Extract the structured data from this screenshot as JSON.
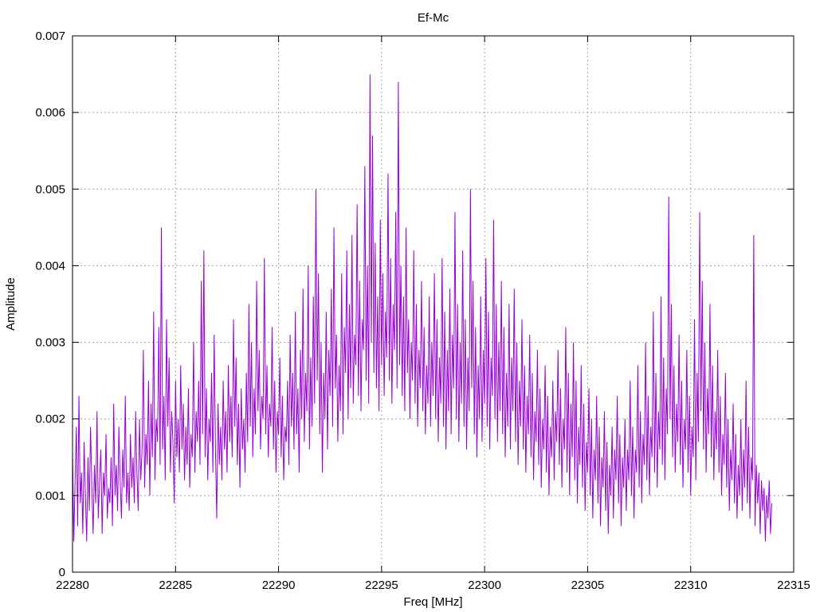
{
  "chart_data": {
    "type": "line",
    "title": "Ef-Mc",
    "xlabel": "Freq [MHz]",
    "ylabel": "Amplitude",
    "xlim": [
      22280,
      22315
    ],
    "ylim": [
      0,
      0.007
    ],
    "xticks": [
      22280,
      22285,
      22290,
      22295,
      22300,
      22305,
      22310,
      22315
    ],
    "yticks": [
      0,
      0.001,
      0.002,
      0.003,
      0.004,
      0.005,
      0.006,
      0.007
    ],
    "xtick_labels": [
      "22280",
      "22285",
      "22290",
      "22295",
      "22300",
      "22305",
      "22310",
      "22315"
    ],
    "ytick_labels": [
      "0",
      "0.001",
      "0.002",
      "0.003",
      "0.004",
      "0.005",
      "0.006",
      "0.007"
    ],
    "grid": true,
    "legend": "none",
    "series_color": "#9400d3",
    "series": [
      {
        "x_start": 22280.0,
        "x_step": 0.0625,
        "values": [
          0.0016,
          0.0004,
          0.0012,
          0.0019,
          0.0006,
          0.0023,
          0.0009,
          0.0013,
          0.0005,
          0.0017,
          0.001,
          0.0004,
          0.0015,
          0.0008,
          0.0019,
          0.0011,
          0.0005,
          0.0014,
          0.0009,
          0.0021,
          0.0007,
          0.0012,
          0.0016,
          0.0005,
          0.0013,
          0.001,
          0.0018,
          0.0007,
          0.0011,
          0.0009,
          0.0015,
          0.0006,
          0.0022,
          0.001,
          0.0014,
          0.0008,
          0.0019,
          0.0012,
          0.0007,
          0.0016,
          0.0011,
          0.0023,
          0.0009,
          0.0013,
          0.0008,
          0.0018,
          0.0011,
          0.0015,
          0.0009,
          0.0021,
          0.0013,
          0.0008,
          0.002,
          0.0012,
          0.0016,
          0.0029,
          0.0011,
          0.0018,
          0.0014,
          0.0025,
          0.001,
          0.0022,
          0.0015,
          0.0034,
          0.0012,
          0.002,
          0.0017,
          0.0032,
          0.0014,
          0.0045,
          0.0016,
          0.0023,
          0.0012,
          0.0033,
          0.0019,
          0.0028,
          0.0013,
          0.0021,
          0.0017,
          0.0009,
          0.0025,
          0.0015,
          0.002,
          0.0013,
          0.0027,
          0.0016,
          0.0022,
          0.0012,
          0.0019,
          0.0014,
          0.0024,
          0.0011,
          0.0018,
          0.0015,
          0.003,
          0.0013,
          0.0021,
          0.0017,
          0.0025,
          0.0014,
          0.0038,
          0.0018,
          0.0042,
          0.0015,
          0.0024,
          0.0012,
          0.002,
          0.0017,
          0.0026,
          0.0013,
          0.0031,
          0.0016,
          0.0007,
          0.0022,
          0.0014,
          0.0019,
          0.0012,
          0.0025,
          0.0016,
          0.0021,
          0.0013,
          0.0027,
          0.0017,
          0.0023,
          0.0015,
          0.0033,
          0.0019,
          0.0028,
          0.0014,
          0.0022,
          0.0011,
          0.0024,
          0.0016,
          0.002,
          0.0013,
          0.0026,
          0.0017,
          0.0035,
          0.0019,
          0.003,
          0.0015,
          0.0024,
          0.0018,
          0.0038,
          0.0021,
          0.0029,
          0.0016,
          0.0023,
          0.002,
          0.0041,
          0.0018,
          0.0027,
          0.0015,
          0.0022,
          0.0019,
          0.0032,
          0.0016,
          0.0025,
          0.0013,
          0.0021,
          0.0018,
          0.0028,
          0.0015,
          0.0023,
          0.0012,
          0.0019,
          0.0017,
          0.0025,
          0.0014,
          0.0031,
          0.0019,
          0.0026,
          0.0016,
          0.0034,
          0.0018,
          0.0024,
          0.0013,
          0.0029,
          0.002,
          0.0037,
          0.0017,
          0.0026,
          0.0021,
          0.004,
          0.0016,
          0.0028,
          0.0019,
          0.0036,
          0.0022,
          0.005,
          0.0025,
          0.0039,
          0.0018,
          0.003,
          0.0013,
          0.0026,
          0.002,
          0.0034,
          0.0016,
          0.0029,
          0.0023,
          0.0037,
          0.0019,
          0.0045,
          0.0024,
          0.0031,
          0.0017,
          0.0027,
          0.0021,
          0.0039,
          0.0018,
          0.0032,
          0.0026,
          0.0042,
          0.002,
          0.0035,
          0.0024,
          0.0044,
          0.0022,
          0.0031,
          0.0027,
          0.0048,
          0.0023,
          0.0038,
          0.0021,
          0.0033,
          0.0029,
          0.0053,
          0.0025,
          0.004,
          0.0022,
          0.0065,
          0.003,
          0.0057,
          0.0026,
          0.0043,
          0.0024,
          0.0036,
          0.0021,
          0.0046,
          0.0027,
          0.0039,
          0.0023,
          0.0034,
          0.0028,
          0.0052,
          0.0025,
          0.0041,
          0.0022,
          0.0035,
          0.0029,
          0.0047,
          0.0024,
          0.0064,
          0.0027,
          0.004,
          0.0023,
          0.0036,
          0.0021,
          0.0045,
          0.0026,
          0.0033,
          0.002,
          0.003,
          0.0025,
          0.0042,
          0.0022,
          0.0035,
          0.0019,
          0.0029,
          0.0024,
          0.0038,
          0.0021,
          0.0032,
          0.0018,
          0.0027,
          0.0022,
          0.0036,
          0.0019,
          0.003,
          0.0023,
          0.0039,
          0.002,
          0.0033,
          0.0017,
          0.0028,
          0.0022,
          0.0041,
          0.0019,
          0.0034,
          0.0016,
          0.0029,
          0.0021,
          0.0037,
          0.0018,
          0.0031,
          0.0024,
          0.0047,
          0.002,
          0.0035,
          0.0017,
          0.003,
          0.0022,
          0.0042,
          0.0019,
          0.0033,
          0.0016,
          0.0028,
          0.0021,
          0.005,
          0.0024,
          0.0038,
          0.0018,
          0.0032,
          0.0015,
          0.0027,
          0.002,
          0.0036,
          0.0017,
          0.0029,
          0.0022,
          0.0041,
          0.0019,
          0.0034,
          0.0016,
          0.0028,
          0.0023,
          0.0046,
          0.002,
          0.0035,
          0.0017,
          0.003,
          0.0021,
          0.0038,
          0.0018,
          0.0032,
          0.0015,
          0.0026,
          0.0019,
          0.0035,
          0.0016,
          0.0028,
          0.0021,
          0.0037,
          0.0017,
          0.003,
          0.0014,
          0.0025,
          0.0019,
          0.0033,
          0.0016,
          0.0027,
          0.0013,
          0.0023,
          0.0018,
          0.0031,
          0.0015,
          0.0026,
          0.0012,
          0.0021,
          0.0017,
          0.0029,
          0.0014,
          0.0024,
          0.0011,
          0.002,
          0.0016,
          0.0027,
          0.0013,
          0.0023,
          0.001,
          0.0019,
          0.0015,
          0.0025,
          0.0012,
          0.0021,
          0.0017,
          0.0029,
          0.0014,
          0.0024,
          0.0011,
          0.002,
          0.0016,
          0.0032,
          0.0013,
          0.0026,
          0.001,
          0.0022,
          0.0015,
          0.003,
          0.0012,
          0.0025,
          0.0009,
          0.0019,
          0.0014,
          0.0027,
          0.0011,
          0.0022,
          0.0008,
          0.0017,
          0.0013,
          0.0024,
          0.001,
          0.002,
          0.0007,
          0.0016,
          0.0012,
          0.0023,
          0.0009,
          0.0019,
          0.0006,
          0.0015,
          0.0011,
          0.0021,
          0.0008,
          0.0017,
          0.0005,
          0.0014,
          0.001,
          0.0019,
          0.0007,
          0.0016,
          0.0012,
          0.0023,
          0.0009,
          0.0018,
          0.0006,
          0.0015,
          0.0011,
          0.002,
          0.0008,
          0.0016,
          0.0012,
          0.0025,
          0.001,
          0.0019,
          0.0007,
          0.0016,
          0.0013,
          0.0027,
          0.0011,
          0.0021,
          0.0009,
          0.0018,
          0.0014,
          0.003,
          0.0012,
          0.0023,
          0.001,
          0.0019,
          0.0015,
          0.0034,
          0.0013,
          0.0026,
          0.0011,
          0.0021,
          0.0016,
          0.0036,
          0.0014,
          0.0028,
          0.0012,
          0.0024,
          0.0018,
          0.0049,
          0.002,
          0.0035,
          0.0015,
          0.0027,
          0.0013,
          0.0022,
          0.0017,
          0.0031,
          0.0014,
          0.0025,
          0.0011,
          0.002,
          0.0016,
          0.0029,
          0.0013,
          0.0023,
          0.001,
          0.0019,
          0.0015,
          0.0033,
          0.0012,
          0.0026,
          0.0017,
          0.0047,
          0.0021,
          0.0038,
          0.0016,
          0.003,
          0.0013,
          0.0024,
          0.0018,
          0.0035,
          0.0015,
          0.0027,
          0.0012,
          0.0021,
          0.0016,
          0.0029,
          0.0013,
          0.0023,
          0.001,
          0.0018,
          0.0014,
          0.0026,
          0.0011,
          0.002,
          0.0008,
          0.0016,
          0.0012,
          0.0022,
          0.0009,
          0.0018,
          0.0007,
          0.0014,
          0.001,
          0.002,
          0.0008,
          0.0016,
          0.0011,
          0.0025,
          0.0009,
          0.0019,
          0.0007,
          0.0015,
          0.0012,
          0.0044,
          0.0006,
          0.0014,
          0.0009,
          0.0013,
          0.0005,
          0.0012,
          0.0008,
          0.0011,
          0.0004,
          0.001,
          0.0007,
          0.0012,
          0.0005,
          0.0009
        ]
      }
    ]
  }
}
